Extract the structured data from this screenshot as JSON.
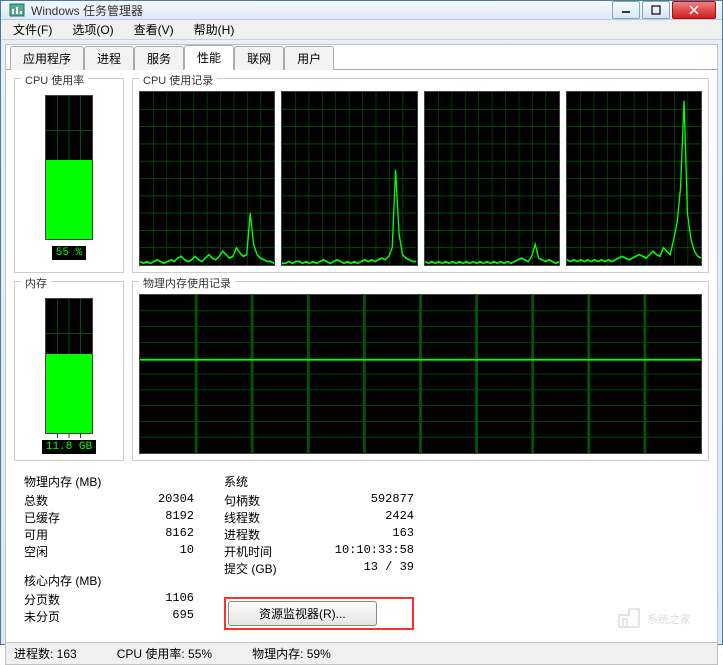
{
  "window": {
    "title": "Windows 任务管理器"
  },
  "menu": {
    "file": "文件(F)",
    "options": "选项(O)",
    "view": "查看(V)",
    "help": "帮助(H)"
  },
  "tabs": {
    "apps": "应用程序",
    "processes": "进程",
    "services": "服务",
    "performance": "性能",
    "network": "联网",
    "users": "用户"
  },
  "gauge": {
    "cpu_title": "CPU 使用率",
    "cpu_pct": 55,
    "cpu_label": "55 %",
    "mem_title": "内存",
    "mem_pct": 59,
    "mem_label": "11.8 GB"
  },
  "history": {
    "cpu_title": "CPU 使用记录",
    "mem_title": "物理内存使用记录"
  },
  "phys_mem": {
    "header": "物理内存 (MB)",
    "total_k": "总数",
    "total_v": "20304",
    "cached_k": "已缓存",
    "cached_v": "8192",
    "avail_k": "可用",
    "avail_v": "8162",
    "free_k": "空闲",
    "free_v": "10"
  },
  "kernel_mem": {
    "header": "核心内存 (MB)",
    "paged_k": "分页数",
    "paged_v": "1106",
    "nonpaged_k": "未分页",
    "nonpaged_v": "695"
  },
  "sys": {
    "header": "系统",
    "handles_k": "句柄数",
    "handles_v": "592877",
    "threads_k": "线程数",
    "threads_v": "2424",
    "procs_k": "进程数",
    "procs_v": "163",
    "uptime_k": "开机时间",
    "uptime_v": "10:10:33:58",
    "commit_k": "提交 (GB)",
    "commit_v": "13 / 39"
  },
  "resource_btn": "资源监视器(R)...",
  "status": {
    "procs": "进程数: 163",
    "cpu": "CPU 使用率: 55%",
    "mem": "物理内存: 59%"
  },
  "chart_data": [
    {
      "type": "line",
      "title": "CPU core 1",
      "ylim": [
        0,
        100
      ],
      "values": [
        2,
        1,
        2,
        1,
        2,
        3,
        2,
        1,
        2,
        3,
        2,
        4,
        5,
        3,
        2,
        3,
        5,
        3,
        2,
        4,
        6,
        4,
        3,
        5,
        8,
        6,
        4,
        5,
        10,
        7,
        5,
        6,
        30,
        12,
        6,
        4,
        3,
        2,
        2,
        1
      ]
    },
    {
      "type": "line",
      "title": "CPU core 2",
      "ylim": [
        0,
        100
      ],
      "values": [
        1,
        1,
        2,
        1,
        2,
        2,
        1,
        2,
        1,
        2,
        1,
        2,
        3,
        2,
        1,
        2,
        3,
        2,
        1,
        2,
        1,
        2,
        1,
        2,
        3,
        2,
        3,
        2,
        3,
        4,
        3,
        5,
        10,
        55,
        18,
        6,
        4,
        3,
        2,
        2
      ]
    },
    {
      "type": "line",
      "title": "CPU core 3",
      "ylim": [
        0,
        100
      ],
      "values": [
        2,
        1,
        2,
        1,
        2,
        1,
        2,
        1,
        2,
        1,
        2,
        1,
        2,
        1,
        2,
        1,
        2,
        1,
        2,
        1,
        2,
        1,
        2,
        1,
        2,
        1,
        2,
        3,
        4,
        3,
        2,
        5,
        12,
        4,
        3,
        2,
        3,
        2,
        1,
        2
      ]
    },
    {
      "type": "line",
      "title": "CPU core 4",
      "ylim": [
        0,
        100
      ],
      "values": [
        3,
        2,
        3,
        2,
        3,
        2,
        3,
        2,
        3,
        2,
        3,
        2,
        3,
        2,
        3,
        4,
        5,
        4,
        3,
        4,
        5,
        6,
        5,
        4,
        6,
        8,
        6,
        5,
        10,
        8,
        6,
        15,
        25,
        45,
        95,
        30,
        15,
        8,
        5,
        4
      ]
    },
    {
      "type": "line",
      "title": "Physical memory",
      "ylim": [
        0,
        100
      ],
      "values": [
        59,
        59,
        59,
        59,
        59,
        59,
        59,
        59,
        59,
        59,
        59,
        59,
        59,
        59,
        59,
        59,
        59,
        59,
        59,
        59,
        59,
        59,
        59,
        59,
        59,
        59,
        59,
        59,
        59,
        59,
        59,
        59,
        59,
        59,
        59,
        59,
        59,
        59,
        59,
        59
      ]
    }
  ]
}
